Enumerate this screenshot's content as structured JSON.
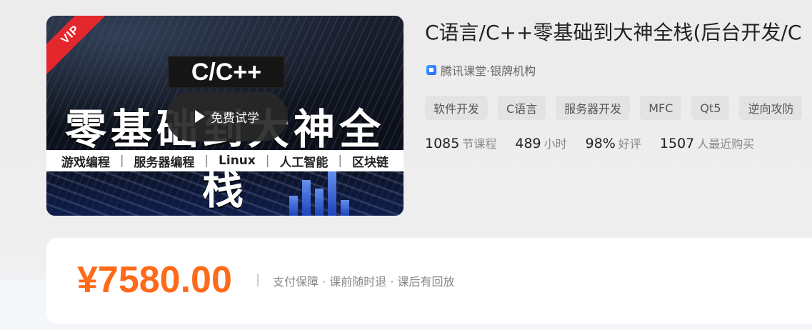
{
  "thumbnail": {
    "vip_label": "VIP",
    "language_label": "C/C++",
    "headline": "零基础到大神全栈",
    "play_button_label": "免费试学",
    "topics": [
      "游戏编程",
      "服务器编程",
      "Linux",
      "人工智能",
      "区块链"
    ],
    "separator": "|"
  },
  "course": {
    "title": "C语言/C++零基础到大神全栈(后台开发/C",
    "org": "腾讯课堂·银牌机构",
    "tags": [
      "软件开发",
      "C语言",
      "服务器开发",
      "MFC",
      "Qt5",
      "逆向攻防"
    ],
    "stats": [
      {
        "num": "1085",
        "unit": "节课程"
      },
      {
        "num": "489",
        "unit": "小时"
      },
      {
        "num": "98%",
        "unit": "好评"
      },
      {
        "num": "1507",
        "unit": "人最近购买"
      }
    ]
  },
  "pricing": {
    "price": "¥7580.00",
    "separator": "|",
    "guarantee": "支付保障 · 课前随时退 · 课后有回放"
  },
  "colors": {
    "price": "#ff6a1a",
    "vip": "#e3272d"
  },
  "icons": {
    "org_badge": "shield-badge-icon",
    "play": "play-icon"
  }
}
